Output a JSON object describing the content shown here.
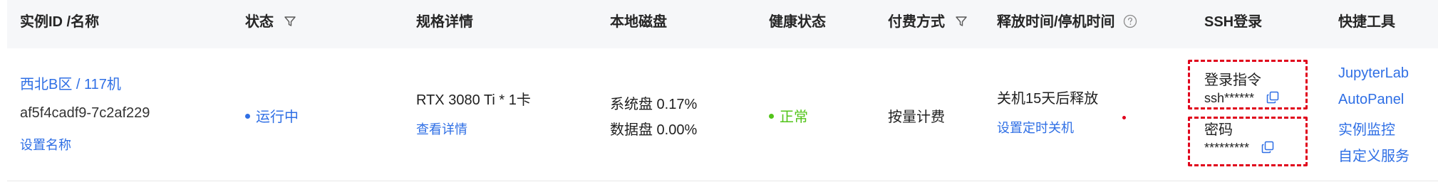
{
  "headers": {
    "instance": "实例ID /名称",
    "status": "状态",
    "spec": "规格详情",
    "disk": "本地磁盘",
    "health": "健康状态",
    "billing": "付费方式",
    "release": "释放时间/停机时间",
    "ssh": "SSH登录",
    "tools": "快捷工具"
  },
  "row": {
    "region": "西北B区 / 117机",
    "instance_id": "af5f4cadf9-7c2af229",
    "set_name": "设置名称",
    "status": "运行中",
    "gpu": "RTX 3080 Ti * 1卡",
    "view_details": "查看详情",
    "system_disk": "系统盘 0.17%",
    "data_disk": "数据盘 0.00%",
    "health": "正常",
    "billing": "按量计费",
    "release_info": "关机15天后释放",
    "schedule_shutdown": "设置定时关机",
    "ssh_login_cmd_label": "登录指令",
    "ssh_login_cmd_value": "ssh******",
    "password_label": "密码",
    "password_value": "*********",
    "tools": [
      "JupyterLab",
      "AutoPanel",
      "实例监控",
      "自定义服务"
    ]
  },
  "colors": {
    "link": "#2f6fe5",
    "status_running": "#2f6fe5",
    "health_ok": "#52c41a",
    "annotation_red": "#e0001b",
    "header_bg": "#f6f7f9"
  },
  "icons": {
    "status_filter": "filter-icon",
    "billing_filter": "filter-icon",
    "release_help": "question-circle-icon",
    "copy": "copy-icon"
  }
}
